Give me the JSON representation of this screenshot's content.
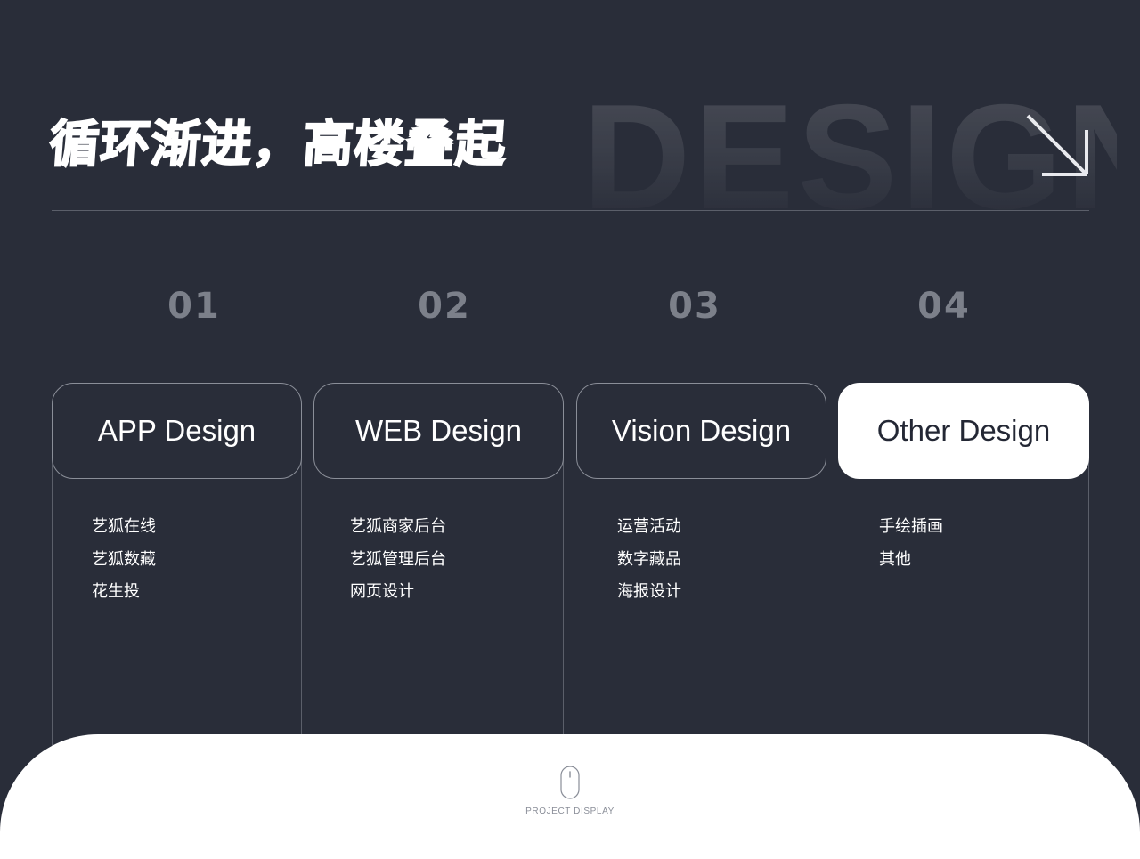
{
  "header": {
    "title": "循环渐进，高楼叠起",
    "background_word": "DESIGN",
    "arrow_icon": "arrow-down-right-icon"
  },
  "categories": [
    {
      "number": "01",
      "title": "APP Design",
      "items": [
        "艺狐在线",
        "艺狐数藏",
        "花生投"
      ]
    },
    {
      "number": "02",
      "title": "WEB Design",
      "items": [
        "艺狐商家后台",
        "艺狐管理后台",
        "网页设计"
      ]
    },
    {
      "number": "03",
      "title": "Vision Design",
      "items": [
        "运营活动",
        "数字藏品",
        "海报设计"
      ]
    },
    {
      "number": "04",
      "title": "Other Design",
      "items": [
        "手绘插画",
        "其他"
      ]
    }
  ],
  "selected_category": "Other Design",
  "footer": {
    "icon": "mouse-icon",
    "label": "PROJECT DISPLAY"
  },
  "colors": {
    "background": "#292d39",
    "card_border": "#8a8e98",
    "active_card": "#ffffff",
    "number_text": "#7c808a"
  }
}
